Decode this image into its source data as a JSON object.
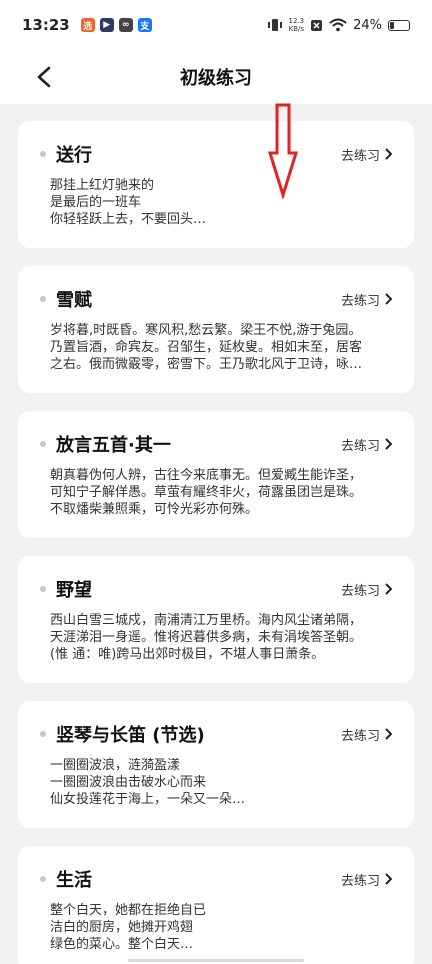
{
  "status_bar": {
    "time": "13:23",
    "app_icons": [
      {
        "name": "app-icon-orange",
        "glyph": "选",
        "color": "#f0642a"
      },
      {
        "name": "app-icon-play",
        "glyph": "▶",
        "color": "#2e3a66"
      },
      {
        "name": "app-icon-swirl",
        "glyph": "∞",
        "color": "#444444"
      },
      {
        "name": "app-icon-blue",
        "glyph": "支",
        "color": "#1677ff"
      }
    ],
    "net_speed_value": "12.3",
    "net_speed_unit": "KB/s",
    "battery": "24%",
    "battery_level": 0.24
  },
  "header": {
    "title": "初级练习"
  },
  "cards": [
    {
      "title": "送行",
      "action": "去练习",
      "lines": [
        "那挂上红灯驰来的",
        "是最后的一班车",
        "你轻轻跃上去，不要回头…"
      ]
    },
    {
      "title": "雪赋",
      "action": "去练习",
      "lines": [
        "岁将暮,时既昏。寒风积,愁云繁。梁王不悦,游于兔园。",
        "乃置旨酒，命宾友。召邹生，延枚叟。相如末至，居客",
        "之右。俄而微霰零，密雪下。王乃歌北风于卫诗，咏…"
      ]
    },
    {
      "title": "放言五首·其一",
      "action": "去练习",
      "lines": [
        "朝真暮伪何人辨，古往今来底事无。但爱臧生能诈圣，",
        "可知宁子解佯愚。草萤有耀终非火，荷露虽团岂是珠。",
        "不取燔柴兼照乘，可怜光彩亦何殊。"
      ]
    },
    {
      "title": "野望",
      "action": "去练习",
      "lines": [
        "西山白雪三城戍，南浦清江万里桥。海内风尘诸弟隔，",
        "天涯涕泪一身遥。惟将迟暮供多病，未有涓埃答圣朝。",
        "(惟 通：唯)跨马出郊时极目，不堪人事日萧条。"
      ]
    },
    {
      "title": "竖琴与长笛 (节选)",
      "action": "去练习",
      "lines": [
        "一圈圈波浪，涟漪盈漾",
        "一圈圈波浪由击破水心而来",
        "仙女投莲花于海上，一朵又一朵…"
      ]
    },
    {
      "title": "生活",
      "action": "去练习",
      "lines": [
        "整个白天，她都在拒绝自已",
        "洁白的厨房，她摊开鸡翅",
        "绿色的菜心。整个白天…"
      ]
    }
  ],
  "colors": {
    "background": "#f2f2f2",
    "card": "#ffffff",
    "annotation": "#e32222",
    "text_primary": "#111111",
    "text_secondary": "#333333"
  }
}
